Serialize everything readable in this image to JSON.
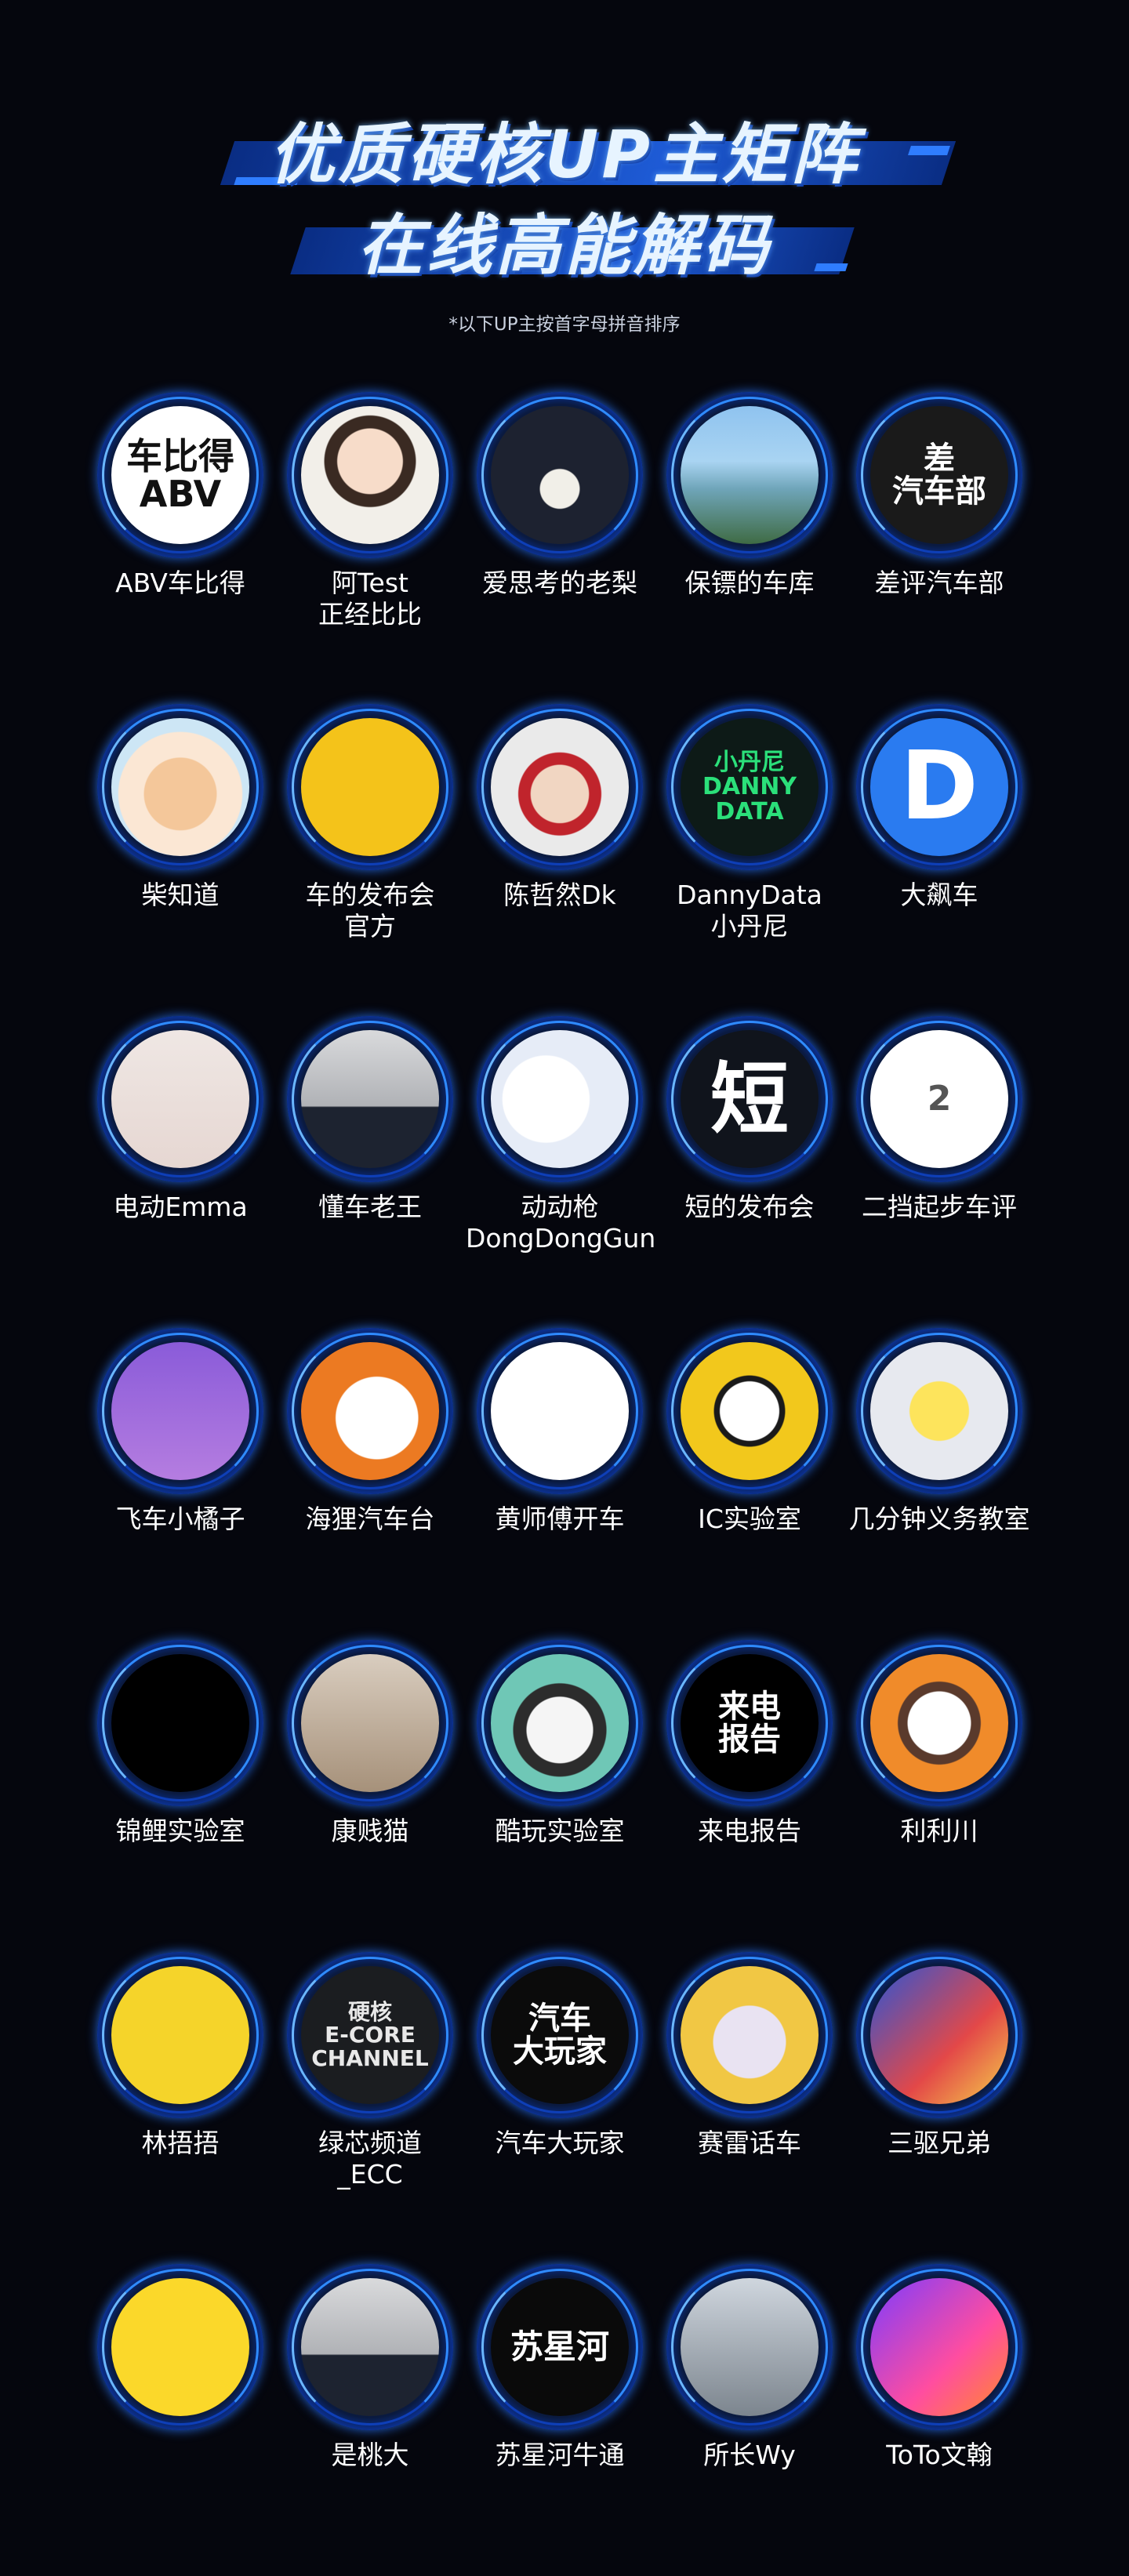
{
  "header": {
    "title_line_1": "优质硬核UP主矩阵",
    "title_line_2": "在线高能解码",
    "subtitle": "*以下UP主按首字母拼音排序"
  },
  "colors": {
    "background": "#05060d",
    "accent_blue": "#1e6bff",
    "title_text": "#e7f4ff"
  },
  "creators": [
    [
      {
        "name": "ABV车比得",
        "avatar_text": "车比得\nABV",
        "avatar_icon": "abv-logo-icon"
      },
      {
        "name": "阿Test\n正经比比",
        "avatar_text": "",
        "avatar_icon": "cartoon-man-icon"
      },
      {
        "name": "爱思考的老梨",
        "avatar_text": "",
        "avatar_icon": "night-figure-icon"
      },
      {
        "name": "保镖的车库",
        "avatar_text": "",
        "avatar_icon": "photo-person-sea-icon"
      },
      {
        "name": "差评汽车部",
        "avatar_text": "差\n汽车部",
        "avatar_icon": "chaping-logo-icon"
      }
    ],
    [
      {
        "name": "柴知道",
        "avatar_text": "",
        "avatar_icon": "shiba-dog-icon"
      },
      {
        "name": "车的发布会\n官方",
        "avatar_text": "",
        "avatar_icon": "steering-wheel-mic-icon"
      },
      {
        "name": "陈哲然Dk",
        "avatar_text": "",
        "avatar_icon": "cartoon-dk-icon"
      },
      {
        "name": "DannyData\n小丹尼",
        "avatar_text": "小丹尼\nDANNY DATA",
        "avatar_icon": "danny-logo-icon"
      },
      {
        "name": "大飙车",
        "avatar_text": "D",
        "avatar_icon": "d-logo-icon"
      }
    ],
    [
      {
        "name": "电动Emma",
        "avatar_text": "",
        "avatar_icon": "photo-woman-icon"
      },
      {
        "name": "懂车老王",
        "avatar_text": "",
        "avatar_icon": "photo-man-glasses-icon"
      },
      {
        "name": "动动枪\nDongDongGun",
        "avatar_text": "",
        "avatar_icon": "cartoon-cat-gun-icon"
      },
      {
        "name": "短的发布会",
        "avatar_text": "短",
        "avatar_icon": "duan-logo-icon"
      },
      {
        "name": "二挡起步车评",
        "avatar_text": "2",
        "avatar_icon": "gear-shift-icon"
      }
    ],
    [
      {
        "name": "飞车小橘子",
        "avatar_text": "",
        "avatar_icon": "photo-girl-icon"
      },
      {
        "name": "海狸汽车台",
        "avatar_text": "",
        "avatar_icon": "beaver-icon"
      },
      {
        "name": "黄师傅开车",
        "avatar_text": "",
        "avatar_icon": "sketch-man-icon"
      },
      {
        "name": "IC实验室",
        "avatar_text": "",
        "avatar_icon": "panda-icon"
      },
      {
        "name": "几分钟义务教室",
        "avatar_text": "",
        "avatar_icon": "chick-icon"
      }
    ],
    [
      {
        "name": "锦鲤实验室",
        "avatar_text": "",
        "avatar_icon": "play-button-icon"
      },
      {
        "name": "康贱猫",
        "avatar_text": "",
        "avatar_icon": "photo-man-desk-icon"
      },
      {
        "name": "酷玩实验室",
        "avatar_text": "",
        "avatar_icon": "bulldog-icon"
      },
      {
        "name": "来电报告",
        "avatar_text": "来电\n报告",
        "avatar_icon": "laidian-logo-icon"
      },
      {
        "name": "利利川",
        "avatar_text": "",
        "avatar_icon": "cartoon-dog-doctor-icon"
      }
    ],
    [
      {
        "name": "林捂捂",
        "avatar_text": "",
        "avatar_icon": "cartoon-doctor-icon"
      },
      {
        "name": "绿芯频道\n_ECC",
        "avatar_text": "硬核\nE-CORE CHANNEL",
        "avatar_icon": "ecore-logo-icon"
      },
      {
        "name": "汽车大玩家",
        "avatar_text": "汽车\n大玩家",
        "avatar_icon": "wanjia-logo-icon"
      },
      {
        "name": "赛雷话车",
        "avatar_text": "",
        "avatar_icon": "ghost-wheel-icon"
      },
      {
        "name": "三驱兄弟",
        "avatar_text": "",
        "avatar_icon": "anime-boy-icon"
      }
    ],
    [
      {
        "name": "",
        "avatar_text": "",
        "avatar_icon": "smiley-face-icon"
      },
      {
        "name": "是桃大",
        "avatar_text": "",
        "avatar_icon": "photo-man-glasses-icon"
      },
      {
        "name": "苏星河牛通",
        "avatar_text": "苏星河",
        "avatar_icon": "suxinghe-logo-icon"
      },
      {
        "name": "所长Wy",
        "avatar_text": "",
        "avatar_icon": "photo-man-camera-icon"
      },
      {
        "name": "ToTo文翰",
        "avatar_text": "",
        "avatar_icon": "toto-logo-icon"
      }
    ]
  ]
}
